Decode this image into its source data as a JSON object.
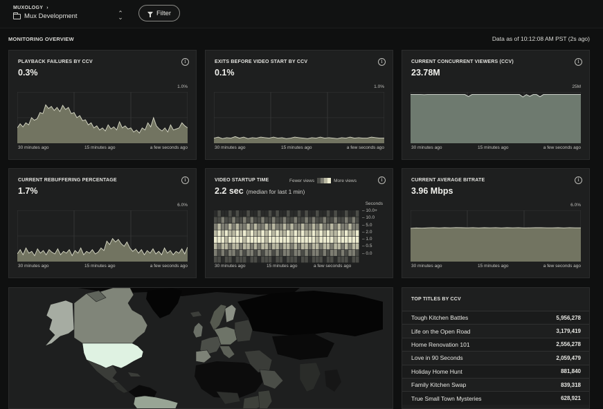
{
  "header": {
    "org": "MUXOLOGY",
    "org_chevron": "›",
    "environment": "Mux Development",
    "environment_switcher": "⌃⌄",
    "filter_label": "Filter"
  },
  "overview": {
    "title": "MONITORING OVERVIEW",
    "as_of": "Data as of 10:12:08 AM PST (2s ago)"
  },
  "time_labels": [
    "30 minutes ago",
    "15 minutes ago",
    "a few seconds ago"
  ],
  "cards": {
    "playback_failures": {
      "title": "PLAYBACK FAILURES BY CCV",
      "value": "0.3%",
      "max": "1.0%"
    },
    "exits_before_start": {
      "title": "EXITS BEFORE VIDEO START BY CCV",
      "value": "0.1%",
      "max": "1.0%"
    },
    "concurrent_viewers": {
      "title": "CURRENT CONCURRENT VIEWERS (CCV)",
      "value": "23.78M",
      "max": "25M"
    },
    "rebuffering": {
      "title": "CURRENT REBUFFERING PERCENTAGE",
      "value": "1.7%",
      "max": "6.0%"
    },
    "startup_time": {
      "title": "VIDEO STARTUP TIME",
      "value": "2.2 sec",
      "subtitle": "(median for last 1 min)",
      "legend_fewer": "Fewer views",
      "legend_more": "More views",
      "y_title": "Seconds",
      "y_ticks": [
        "10.0+",
        "10.0",
        "5.0",
        "2.0",
        "1.0",
        "0.5",
        "0.0"
      ]
    },
    "bitrate": {
      "title": "CURRENT AVERAGE BITRATE",
      "value": "3.96 Mbps",
      "max": "6.0%"
    }
  },
  "top_titles": {
    "title": "TOP TITLES BY CCV",
    "rows": [
      {
        "name": "Tough Kitchen Battles",
        "value": "5,956,278"
      },
      {
        "name": "Life on the Open Road",
        "value": "3,179,419"
      },
      {
        "name": "Home Renovation 101",
        "value": "2,556,278"
      },
      {
        "name": "Love in 90 Seconds",
        "value": "2,059,479"
      },
      {
        "name": "Holiday Home Hunt",
        "value": "881,840"
      },
      {
        "name": "Family Kitchen Swap",
        "value": "839,318"
      },
      {
        "name": "True Small Town Mysteries",
        "value": "628,921"
      }
    ]
  },
  "chart_data": [
    {
      "type": "area",
      "title": "PLAYBACK FAILURES BY CCV",
      "ylim": [
        0,
        1.0
      ],
      "y_unit": "%",
      "x": [
        "30 minutes ago",
        "15 minutes ago",
        "a few seconds ago"
      ],
      "values": [
        0.3,
        0.38,
        0.32,
        0.4,
        0.36,
        0.5,
        0.45,
        0.48,
        0.6,
        0.58,
        0.75,
        0.68,
        0.72,
        0.64,
        0.7,
        0.62,
        0.74,
        0.66,
        0.7,
        0.58,
        0.6,
        0.5,
        0.54,
        0.44,
        0.46,
        0.36,
        0.4,
        0.3,
        0.34,
        0.26,
        0.3,
        0.24,
        0.36,
        0.28,
        0.32,
        0.26,
        0.42,
        0.3,
        0.34,
        0.28,
        0.3,
        0.22,
        0.26,
        0.2,
        0.3,
        0.26,
        0.4,
        0.32,
        0.5,
        0.34,
        0.28,
        0.24,
        0.3,
        0.22,
        0.36,
        0.26,
        0.28,
        0.3,
        0.4,
        0.34,
        0.3
      ]
    },
    {
      "type": "area",
      "title": "EXITS BEFORE VIDEO START BY CCV",
      "ylim": [
        0,
        1.0
      ],
      "y_unit": "%",
      "x": [
        "30 minutes ago",
        "15 minutes ago",
        "a few seconds ago"
      ],
      "values": [
        0.1,
        0.12,
        0.09,
        0.11,
        0.1,
        0.13,
        0.1,
        0.12,
        0.09,
        0.11,
        0.1,
        0.12,
        0.11,
        0.1,
        0.12,
        0.1,
        0.11,
        0.09,
        0.1,
        0.12,
        0.11,
        0.1,
        0.09,
        0.11,
        0.1,
        0.12,
        0.1,
        0.11,
        0.1,
        0.09,
        0.11,
        0.1,
        0.12,
        0.1,
        0.11,
        0.1,
        0.1,
        0.12,
        0.11,
        0.1,
        0.1
      ]
    },
    {
      "type": "area",
      "title": "CURRENT CONCURRENT VIEWERS (CCV)",
      "ylim": [
        0,
        25
      ],
      "y_unit": "M",
      "x": [
        "30 minutes ago",
        "15 minutes ago",
        "a few seconds ago"
      ],
      "values": [
        23.8,
        23.8,
        23.8,
        23.8,
        23.7,
        23.8,
        23.8,
        23.8,
        23.8,
        23.8,
        23.8,
        23.8,
        23.8,
        23.8,
        23.8,
        23.8,
        23.8,
        22.8,
        23.8,
        23.8,
        23.8,
        23.8,
        23.8,
        23.8,
        23.8,
        23.8,
        23.8,
        23.8,
        23.8,
        23.8,
        23.8,
        23.8,
        23.8,
        22.6,
        23.8,
        22.9,
        23.8,
        23.8,
        22.7,
        23.8,
        23.8,
        23.8,
        23.8,
        23.8,
        23.8,
        23.8,
        23.8,
        23.8,
        23.8,
        23.8,
        23.8
      ]
    },
    {
      "type": "area",
      "title": "CURRENT REBUFFERING PERCENTAGE",
      "ylim": [
        0,
        6.0
      ],
      "y_unit": "%",
      "x": [
        "30 minutes ago",
        "15 minutes ago",
        "a few seconds ago"
      ],
      "values": [
        0.9,
        1.4,
        0.8,
        1.6,
        1.0,
        1.2,
        0.7,
        1.5,
        1.0,
        1.3,
        0.8,
        1.4,
        1.1,
        0.9,
        1.5,
        0.8,
        1.2,
        1.0,
        1.4,
        0.7,
        1.3,
        1.0,
        1.6,
        0.8,
        1.2,
        1.0,
        1.4,
        0.9,
        1.1,
        1.6,
        1.3,
        2.4,
        2.0,
        2.7,
        2.3,
        2.6,
        2.1,
        1.8,
        2.3,
        1.6,
        1.2,
        1.5,
        1.0,
        1.4,
        0.8,
        1.3,
        1.0,
        1.5,
        0.9,
        1.2,
        0.8,
        1.6,
        1.0,
        1.3,
        0.8,
        1.2,
        1.0,
        1.5,
        0.9,
        1.7
      ]
    },
    {
      "type": "heatmap",
      "title": "VIDEO STARTUP TIME",
      "y_title": "Seconds",
      "x": [
        "30 minutes ago",
        "15 minutes ago",
        "a few seconds ago"
      ],
      "y": [
        "0.0",
        "0.5",
        "1.0",
        "2.0",
        "5.0",
        "10.0",
        "10.0+"
      ],
      "levels": [
        [
          0,
          1,
          0,
          0,
          1,
          0,
          1,
          0,
          0,
          1,
          0,
          0,
          1,
          0,
          0,
          1,
          0,
          1,
          0,
          0,
          1,
          0,
          0,
          1,
          0,
          1,
          0,
          0,
          1,
          0,
          0,
          1,
          0,
          1,
          0,
          0,
          1,
          0,
          0,
          1
        ],
        [
          1,
          1,
          2,
          1,
          1,
          2,
          1,
          1,
          2,
          1,
          2,
          1,
          1,
          2,
          1,
          1,
          2,
          1,
          1,
          2,
          1,
          1,
          2,
          1,
          1,
          2,
          1,
          2,
          1,
          1,
          2,
          1,
          1,
          2,
          1,
          1,
          2,
          1,
          2,
          1
        ],
        [
          2,
          3,
          2,
          2,
          3,
          2,
          3,
          2,
          2,
          3,
          2,
          3,
          2,
          2,
          3,
          2,
          3,
          2,
          2,
          3,
          2,
          3,
          2,
          2,
          3,
          2,
          2,
          3,
          2,
          3,
          2,
          2,
          3,
          2,
          3,
          2,
          2,
          3,
          2,
          2
        ],
        [
          3,
          4,
          3,
          4,
          3,
          3,
          4,
          3,
          4,
          3,
          4,
          3,
          3,
          4,
          3,
          4,
          3,
          4,
          3,
          3,
          4,
          3,
          4,
          3,
          4,
          3,
          3,
          4,
          3,
          4,
          3,
          4,
          3,
          3,
          4,
          3,
          4,
          3,
          3,
          4
        ],
        [
          4,
          4,
          4,
          3,
          4,
          4,
          4,
          4,
          3,
          4,
          4,
          4,
          4,
          4,
          3,
          4,
          4,
          4,
          4,
          4,
          4,
          3,
          4,
          4,
          4,
          4,
          4,
          4,
          3,
          4,
          4,
          4,
          4,
          3,
          4,
          4,
          4,
          4,
          4,
          4
        ],
        [
          3,
          2,
          3,
          3,
          2,
          3,
          3,
          2,
          3,
          3,
          2,
          3,
          2,
          3,
          3,
          2,
          3,
          3,
          2,
          3,
          3,
          2,
          3,
          2,
          3,
          3,
          2,
          3,
          3,
          2,
          3,
          3,
          2,
          3,
          3,
          2,
          3,
          2,
          3,
          3
        ],
        [
          2,
          1,
          2,
          1,
          2,
          2,
          1,
          2,
          1,
          2,
          2,
          1,
          2,
          1,
          2,
          2,
          1,
          2,
          1,
          2,
          2,
          1,
          2,
          2,
          1,
          2,
          1,
          2,
          2,
          1,
          2,
          1,
          2,
          2,
          1,
          2,
          1,
          2,
          2,
          1
        ],
        [
          1,
          1,
          0,
          1,
          1,
          0,
          1,
          1,
          1,
          0,
          1,
          1,
          0,
          1,
          1,
          1,
          0,
          1,
          1,
          0,
          1,
          1,
          1,
          0,
          1,
          1,
          0,
          1,
          1,
          1,
          0,
          1,
          1,
          0,
          1,
          1,
          1,
          0,
          1,
          1
        ]
      ],
      "scale": [
        "#2a2b2a",
        "#4b4c47",
        "#7d7d72",
        "#b9b8a2",
        "#ecebcf"
      ]
    },
    {
      "type": "area",
      "title": "CURRENT AVERAGE BITRATE",
      "ylim": [
        0,
        6.0
      ],
      "y_unit": "Mbps",
      "x": [
        "30 minutes ago",
        "15 minutes ago",
        "a few seconds ago"
      ],
      "values": [
        3.9,
        3.95,
        3.92,
        3.96,
        3.98,
        3.95,
        3.97,
        3.96,
        3.99,
        3.97,
        3.96,
        3.98,
        3.95,
        3.97,
        3.96,
        3.98,
        3.95,
        3.97,
        3.96,
        3.98,
        3.95,
        3.96,
        3.97,
        3.98,
        3.96,
        3.96,
        3.97,
        3.95,
        3.98,
        3.96,
        3.96
      ]
    }
  ],
  "colors": {
    "area_fill": "#727461",
    "area_line": "#d9dac7",
    "ccv_fill": "#6e7a6f",
    "ccv_line": "#dfe4db",
    "grid": "#3a3b3b"
  }
}
